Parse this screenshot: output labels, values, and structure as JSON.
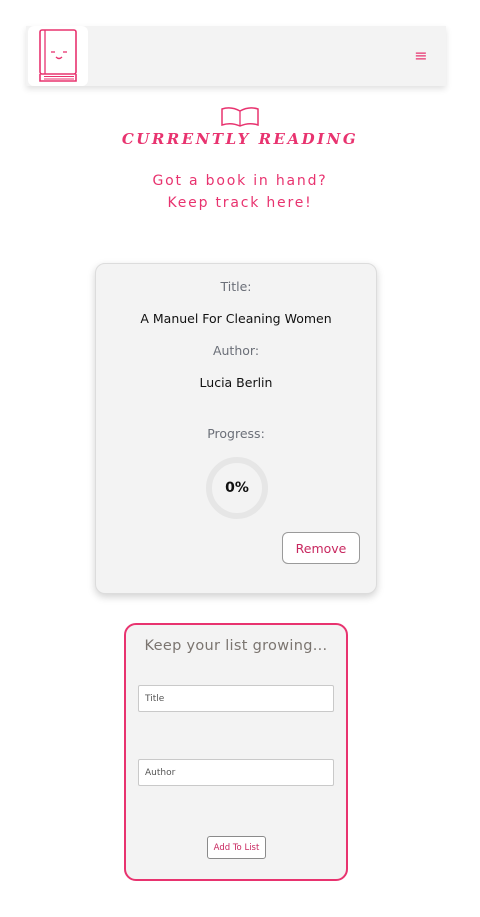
{
  "header": {
    "logo_icon": "smiling-book-icon",
    "menu_icon": "hamburger-menu-icon",
    "menu_glyph": "≡"
  },
  "hero": {
    "icon": "open-book-icon",
    "title": "CURRENTLY READING",
    "tagline_line1": "Got a book in hand?",
    "tagline_line2": "Keep track here!"
  },
  "book_card": {
    "title_label": "Title:",
    "title_value": "A Manuel For Cleaning Women",
    "author_label": "Author:",
    "author_value": "Lucia Berlin",
    "progress_label": "Progress:",
    "progress_value": 0,
    "progress_text": "0%",
    "remove_label": "Remove"
  },
  "add_form": {
    "heading": "Keep your list growing...",
    "title_placeholder": "Title",
    "author_placeholder": "Author",
    "submit_label": "Add To List"
  },
  "colors": {
    "accent": "#e8336f",
    "card_background": "#f3f3f3"
  }
}
